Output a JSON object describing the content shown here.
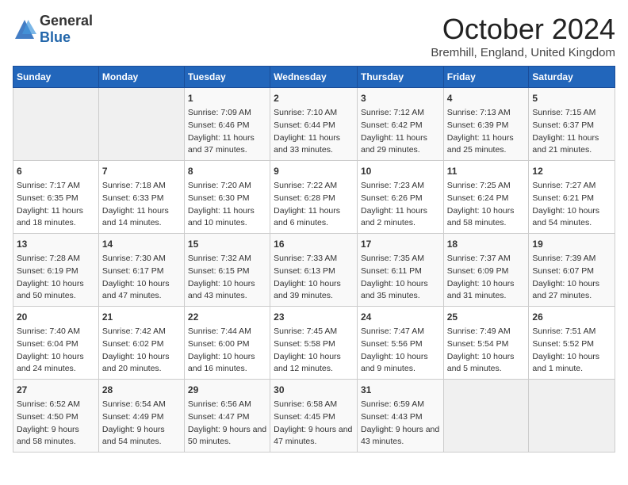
{
  "logo": {
    "general": "General",
    "blue": "Blue"
  },
  "title": "October 2024",
  "location": "Bremhill, England, United Kingdom",
  "days_of_week": [
    "Sunday",
    "Monday",
    "Tuesday",
    "Wednesday",
    "Thursday",
    "Friday",
    "Saturday"
  ],
  "weeks": [
    [
      {
        "day": "",
        "content": ""
      },
      {
        "day": "",
        "content": ""
      },
      {
        "day": "1",
        "content": "Sunrise: 7:09 AM\nSunset: 6:46 PM\nDaylight: 11 hours and 37 minutes."
      },
      {
        "day": "2",
        "content": "Sunrise: 7:10 AM\nSunset: 6:44 PM\nDaylight: 11 hours and 33 minutes."
      },
      {
        "day": "3",
        "content": "Sunrise: 7:12 AM\nSunset: 6:42 PM\nDaylight: 11 hours and 29 minutes."
      },
      {
        "day": "4",
        "content": "Sunrise: 7:13 AM\nSunset: 6:39 PM\nDaylight: 11 hours and 25 minutes."
      },
      {
        "day": "5",
        "content": "Sunrise: 7:15 AM\nSunset: 6:37 PM\nDaylight: 11 hours and 21 minutes."
      }
    ],
    [
      {
        "day": "6",
        "content": "Sunrise: 7:17 AM\nSunset: 6:35 PM\nDaylight: 11 hours and 18 minutes."
      },
      {
        "day": "7",
        "content": "Sunrise: 7:18 AM\nSunset: 6:33 PM\nDaylight: 11 hours and 14 minutes."
      },
      {
        "day": "8",
        "content": "Sunrise: 7:20 AM\nSunset: 6:30 PM\nDaylight: 11 hours and 10 minutes."
      },
      {
        "day": "9",
        "content": "Sunrise: 7:22 AM\nSunset: 6:28 PM\nDaylight: 11 hours and 6 minutes."
      },
      {
        "day": "10",
        "content": "Sunrise: 7:23 AM\nSunset: 6:26 PM\nDaylight: 11 hours and 2 minutes."
      },
      {
        "day": "11",
        "content": "Sunrise: 7:25 AM\nSunset: 6:24 PM\nDaylight: 10 hours and 58 minutes."
      },
      {
        "day": "12",
        "content": "Sunrise: 7:27 AM\nSunset: 6:21 PM\nDaylight: 10 hours and 54 minutes."
      }
    ],
    [
      {
        "day": "13",
        "content": "Sunrise: 7:28 AM\nSunset: 6:19 PM\nDaylight: 10 hours and 50 minutes."
      },
      {
        "day": "14",
        "content": "Sunrise: 7:30 AM\nSunset: 6:17 PM\nDaylight: 10 hours and 47 minutes."
      },
      {
        "day": "15",
        "content": "Sunrise: 7:32 AM\nSunset: 6:15 PM\nDaylight: 10 hours and 43 minutes."
      },
      {
        "day": "16",
        "content": "Sunrise: 7:33 AM\nSunset: 6:13 PM\nDaylight: 10 hours and 39 minutes."
      },
      {
        "day": "17",
        "content": "Sunrise: 7:35 AM\nSunset: 6:11 PM\nDaylight: 10 hours and 35 minutes."
      },
      {
        "day": "18",
        "content": "Sunrise: 7:37 AM\nSunset: 6:09 PM\nDaylight: 10 hours and 31 minutes."
      },
      {
        "day": "19",
        "content": "Sunrise: 7:39 AM\nSunset: 6:07 PM\nDaylight: 10 hours and 27 minutes."
      }
    ],
    [
      {
        "day": "20",
        "content": "Sunrise: 7:40 AM\nSunset: 6:04 PM\nDaylight: 10 hours and 24 minutes."
      },
      {
        "day": "21",
        "content": "Sunrise: 7:42 AM\nSunset: 6:02 PM\nDaylight: 10 hours and 20 minutes."
      },
      {
        "day": "22",
        "content": "Sunrise: 7:44 AM\nSunset: 6:00 PM\nDaylight: 10 hours and 16 minutes."
      },
      {
        "day": "23",
        "content": "Sunrise: 7:45 AM\nSunset: 5:58 PM\nDaylight: 10 hours and 12 minutes."
      },
      {
        "day": "24",
        "content": "Sunrise: 7:47 AM\nSunset: 5:56 PM\nDaylight: 10 hours and 9 minutes."
      },
      {
        "day": "25",
        "content": "Sunrise: 7:49 AM\nSunset: 5:54 PM\nDaylight: 10 hours and 5 minutes."
      },
      {
        "day": "26",
        "content": "Sunrise: 7:51 AM\nSunset: 5:52 PM\nDaylight: 10 hours and 1 minute."
      }
    ],
    [
      {
        "day": "27",
        "content": "Sunrise: 6:52 AM\nSunset: 4:50 PM\nDaylight: 9 hours and 58 minutes."
      },
      {
        "day": "28",
        "content": "Sunrise: 6:54 AM\nSunset: 4:49 PM\nDaylight: 9 hours and 54 minutes."
      },
      {
        "day": "29",
        "content": "Sunrise: 6:56 AM\nSunset: 4:47 PM\nDaylight: 9 hours and 50 minutes."
      },
      {
        "day": "30",
        "content": "Sunrise: 6:58 AM\nSunset: 4:45 PM\nDaylight: 9 hours and 47 minutes."
      },
      {
        "day": "31",
        "content": "Sunrise: 6:59 AM\nSunset: 4:43 PM\nDaylight: 9 hours and 43 minutes."
      },
      {
        "day": "",
        "content": ""
      },
      {
        "day": "",
        "content": ""
      }
    ]
  ]
}
